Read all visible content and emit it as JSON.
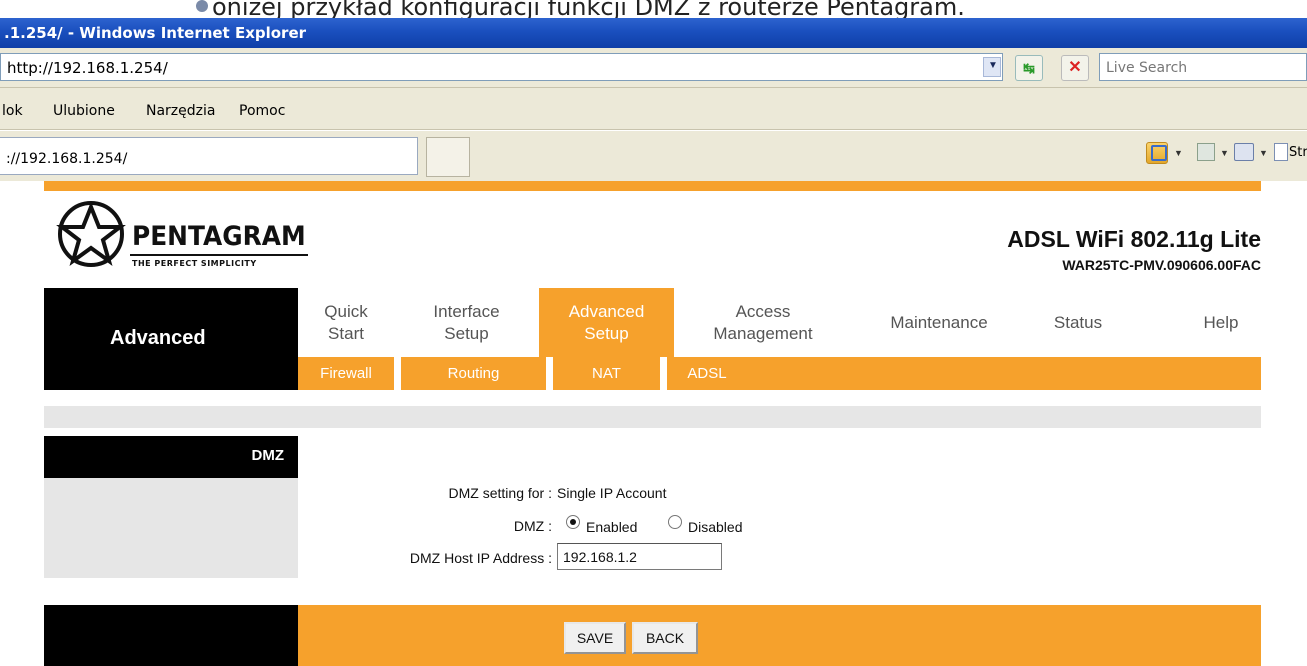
{
  "caption": "oniżej przykład konfiguracji funkcji DMZ z routerze Pentagram.",
  "window": {
    "title": ".1.254/ - Windows Internet Explorer"
  },
  "address_bar": {
    "url": "http://192.168.1.254/",
    "search_placeholder": "Live Search"
  },
  "menu": {
    "items": [
      "lok",
      "Ulubione",
      "Narzędzia",
      "Pomoc"
    ]
  },
  "tab": {
    "title": "://192.168.1.254/"
  },
  "command_bar": {
    "page_label": "Strona"
  },
  "router": {
    "brand": "PENTAGRAM",
    "tagline": "THE PERFECT SIMPLICITY",
    "product": "ADSL WiFi 802.11g Lite",
    "firmware": "WAR25TC-PMV.090606.00FAC",
    "section": "Advanced",
    "nav": [
      {
        "line1": "Quick",
        "line2": "Start"
      },
      {
        "line1": "Interface",
        "line2": "Setup"
      },
      {
        "line1": "Advanced",
        "line2": "Setup",
        "active": true
      },
      {
        "line1": "Access",
        "line2": "Management"
      },
      {
        "line1": "Maintenance",
        "line2": ""
      },
      {
        "line1": "Status",
        "line2": ""
      },
      {
        "line1": "Help",
        "line2": ""
      }
    ],
    "subnav": [
      "Firewall",
      "Routing",
      "NAT",
      "ADSL"
    ]
  },
  "dmz": {
    "heading": "DMZ",
    "setting_for_label": "DMZ setting for :",
    "setting_for_value": "Single IP Account",
    "dmz_label": "DMZ :",
    "enabled_label": "Enabled",
    "disabled_label": "Disabled",
    "selected": "Enabled",
    "host_ip_label": "DMZ Host IP Address :",
    "host_ip_value": "192.168.1.2"
  },
  "buttons": {
    "save": "SAVE",
    "back": "BACK"
  },
  "colors": {
    "orange": "#f6a12c",
    "black": "#000000",
    "xp_blue": "#1a4fbe",
    "chrome": "#ece9d8"
  }
}
